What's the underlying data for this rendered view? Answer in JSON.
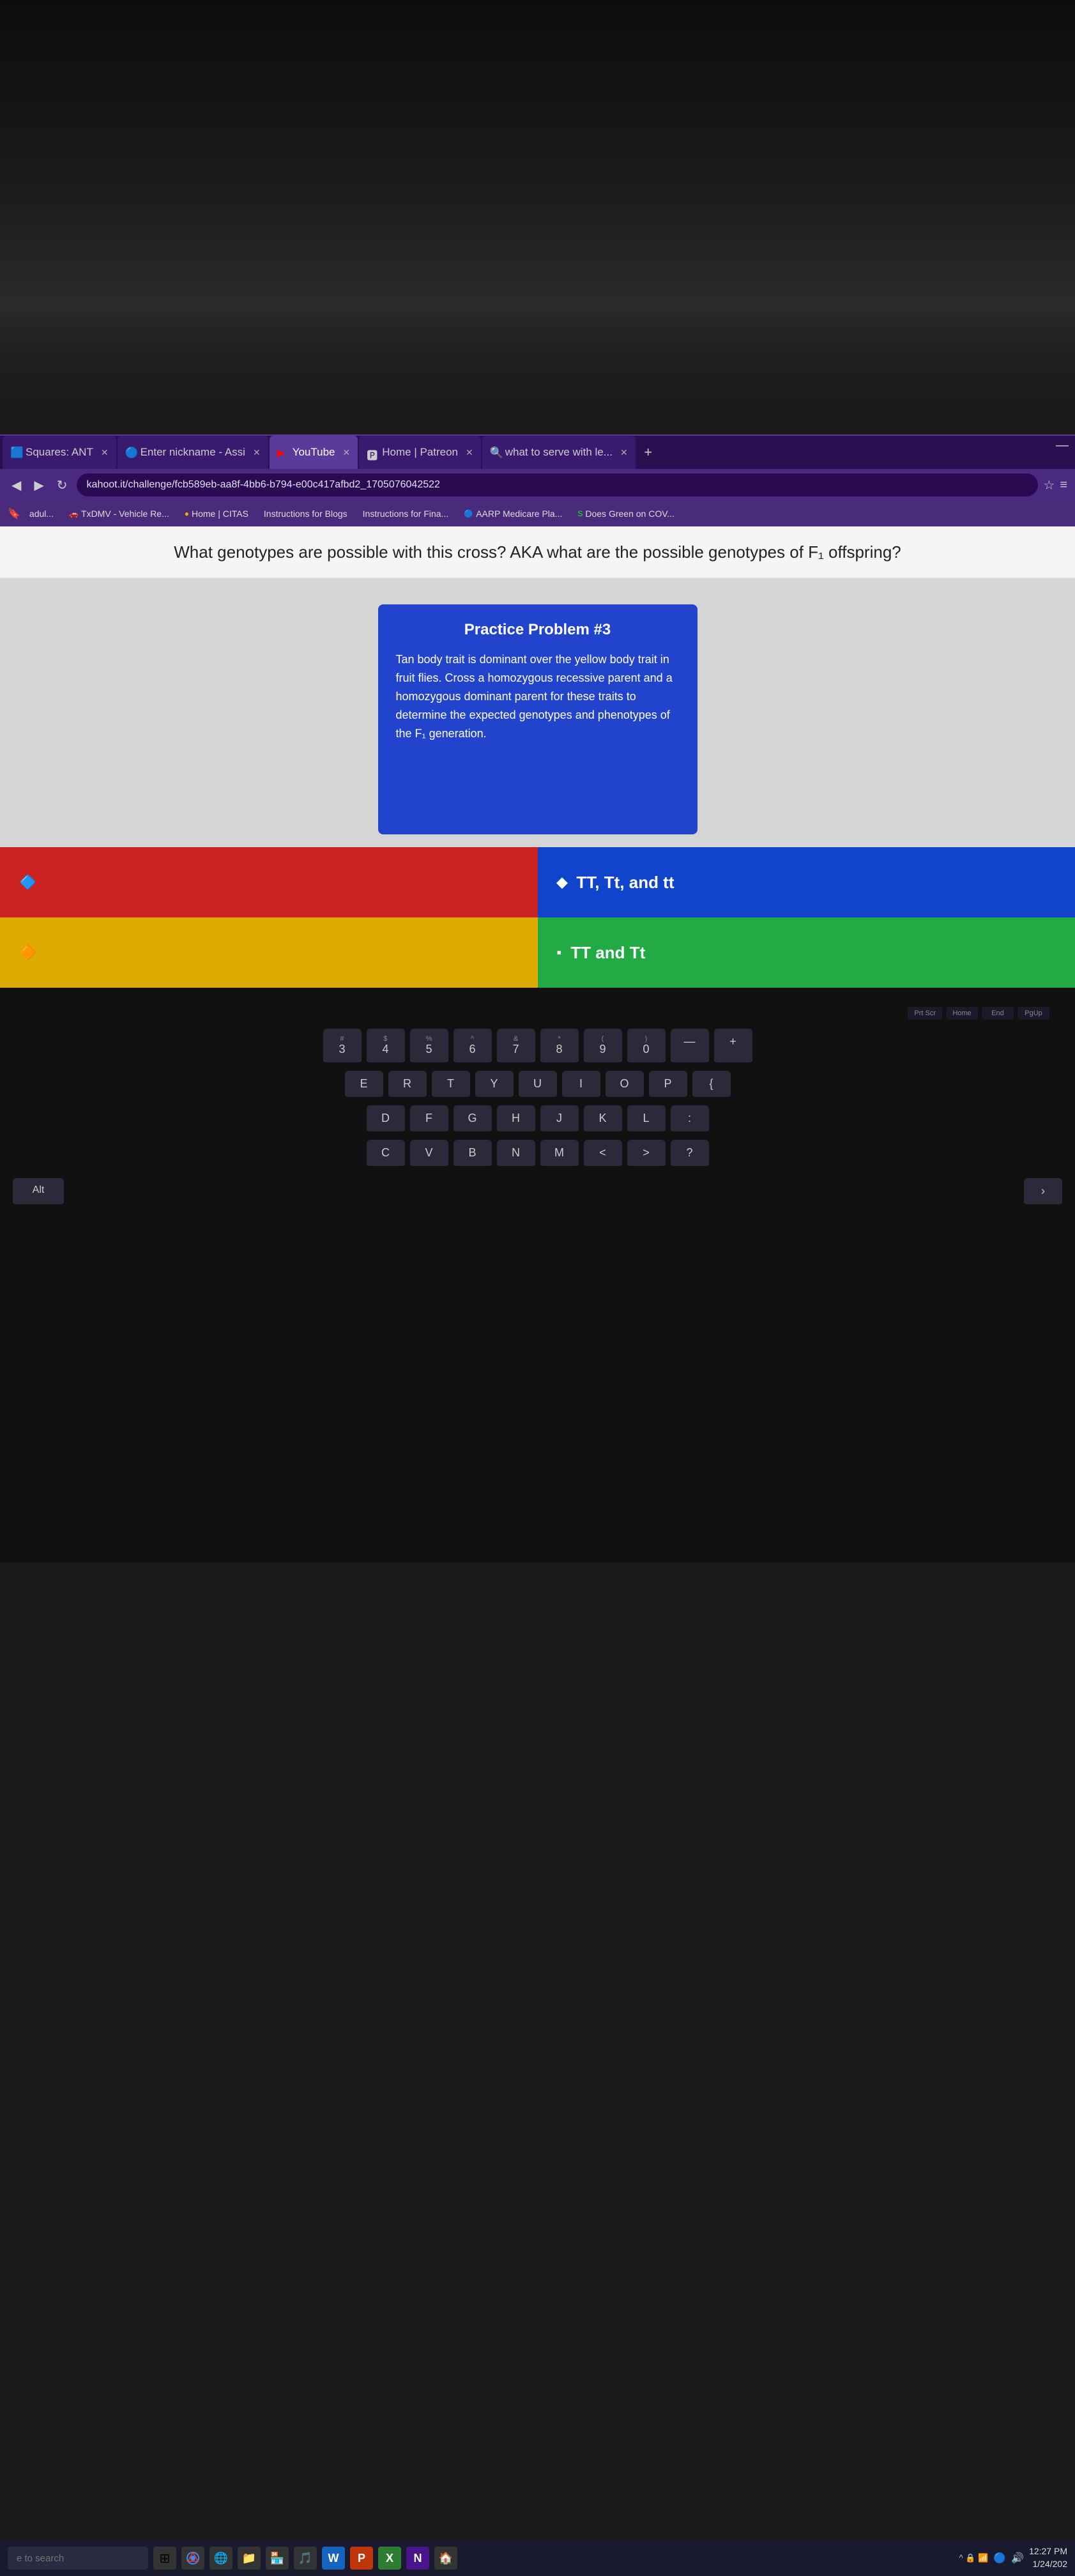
{
  "room": {
    "description": "Dark room background with desk items"
  },
  "browser": {
    "tabs": [
      {
        "id": "tab1",
        "label": "Squares: ANT",
        "favicon": "🟦",
        "active": false,
        "closeable": true
      },
      {
        "id": "tab2",
        "label": "Enter nickname - Assi",
        "favicon": "🔵",
        "active": false,
        "closeable": true
      },
      {
        "id": "tab3",
        "label": "YouTube",
        "favicon": "▶",
        "active": false,
        "closeable": true
      },
      {
        "id": "tab4",
        "label": "Home | Patreon",
        "favicon": "🅿",
        "active": false,
        "closeable": true
      },
      {
        "id": "tab5",
        "label": "what to serve with le...",
        "favicon": "🔍",
        "active": true,
        "closeable": true
      }
    ],
    "address": "kahoot.it/challenge/fcb589eb-aa8f-4bb6-b794-e00c417afbd2_1705076042522",
    "bookmarks": [
      {
        "label": "adul..."
      },
      {
        "label": "TxDMV - Vehicle Re..."
      },
      {
        "label": "Home | CITAS"
      },
      {
        "label": "Instructions for Blogs"
      },
      {
        "label": "Instructions for Fina..."
      },
      {
        "label": "AARP Medicare Pla..."
      },
      {
        "label": "Does Green on COV..."
      }
    ]
  },
  "question": {
    "text": "What genotypes are possible with this cross? AKA what are the possible genotypes of F₁ offspring?"
  },
  "practice_card": {
    "title": "Practice Problem #3",
    "body": "Tan body trait is dominant over the yellow body trait in fruit flies. Cross a homozygous recessive parent and a homozygous dominant parent for these traits to determine the expected genotypes and phenotypes of the F₁ generation."
  },
  "answers": [
    {
      "id": "a",
      "text": "",
      "color": "red",
      "icon": ""
    },
    {
      "id": "b",
      "text": "TT, Tt, and tt",
      "color": "blue",
      "icon": "◆"
    },
    {
      "id": "c",
      "text": "",
      "color": "yellow",
      "icon": ""
    },
    {
      "id": "d",
      "text": "TT and Tt",
      "color": "green",
      "icon": "▪"
    }
  ],
  "taskbar": {
    "search_placeholder": "e to search",
    "clock": "12:27 PM",
    "date": "1/24/202"
  },
  "keyboard": {
    "rows": [
      [
        "#\n3",
        "$\n4",
        "%\n5",
        "^\n6",
        "&\n7",
        "*\n8",
        "(\n9",
        ")\n0",
        "—",
        "+"
      ],
      [
        "E",
        "R",
        "T",
        "Y",
        "U",
        "I",
        "O",
        "P",
        "{"
      ],
      [
        "D",
        "F",
        "G",
        "H",
        "J",
        "K",
        "L",
        ":"
      ],
      [
        "C",
        "V",
        "B",
        "N",
        "M",
        "<",
        ">",
        "?"
      ]
    ],
    "special_keys": {
      "prt_scr": "Prt Scr",
      "home": "Home",
      "end": "End",
      "pg_up": "PgUp"
    },
    "media_keys": [
      "◀◀",
      "◀|",
      "▶|",
      "▶▶",
      "🔇",
      "🔉",
      "🔊"
    ],
    "alt_key": "Alt"
  }
}
